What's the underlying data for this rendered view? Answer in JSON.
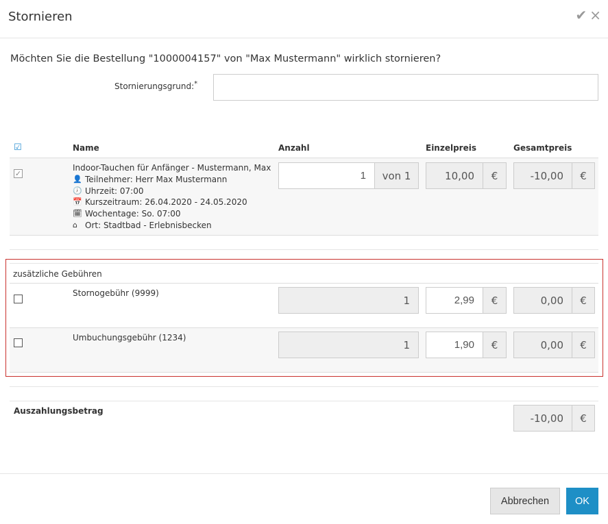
{
  "dialog": {
    "title": "Stornieren",
    "question": "Möchten Sie die Bestellung \"1000004157\" von \"Max Mustermann\" wirklich stornieren?",
    "reason_label": "Stornierungsgrund:",
    "reason_required_mark": "*",
    "reason_value": ""
  },
  "table": {
    "headers": {
      "name": "Name",
      "quantity": "Anzahl",
      "unit_price": "Einzelpreis",
      "total_price": "Gesamtpreis"
    },
    "item": {
      "title": "Indoor-Tauchen für Anfänger - Mustermann, Max",
      "participant": "Teilnehmer: Herr Max Mustermann",
      "time": "Uhrzeit: 07:00",
      "period": "Kurszeitraum: 26.04.2020 - 24.05.2020",
      "weekdays": "Wochentage: So. 07:00",
      "location": "Ort: Stadtbad - Erlebnisbecken",
      "quantity": "1",
      "quantity_of": "von 1",
      "unit_price": "10,00",
      "total_price": "-10,00",
      "currency": "€"
    }
  },
  "fees": {
    "label": "zusätzliche Gebühren",
    "items": [
      {
        "name": "Stornogebühr (9999)",
        "quantity": "1",
        "unit_price": "2,99",
        "total_price": "0,00",
        "currency": "€"
      },
      {
        "name": "Umbuchungsgebühr (1234)",
        "quantity": "1",
        "unit_price": "1,90",
        "total_price": "0,00",
        "currency": "€"
      }
    ]
  },
  "payout": {
    "label": "Auszahlungsbetrag",
    "value": "-10,00",
    "currency": "€"
  },
  "buttons": {
    "cancel": "Abbrechen",
    "ok": "OK"
  },
  "header_icons": {
    "confirm": "✔",
    "close": "×"
  },
  "colors": {
    "accent": "#1e8fc6",
    "fees_border": "#c9302c",
    "checkbox_blue": "#2a8fd1"
  }
}
